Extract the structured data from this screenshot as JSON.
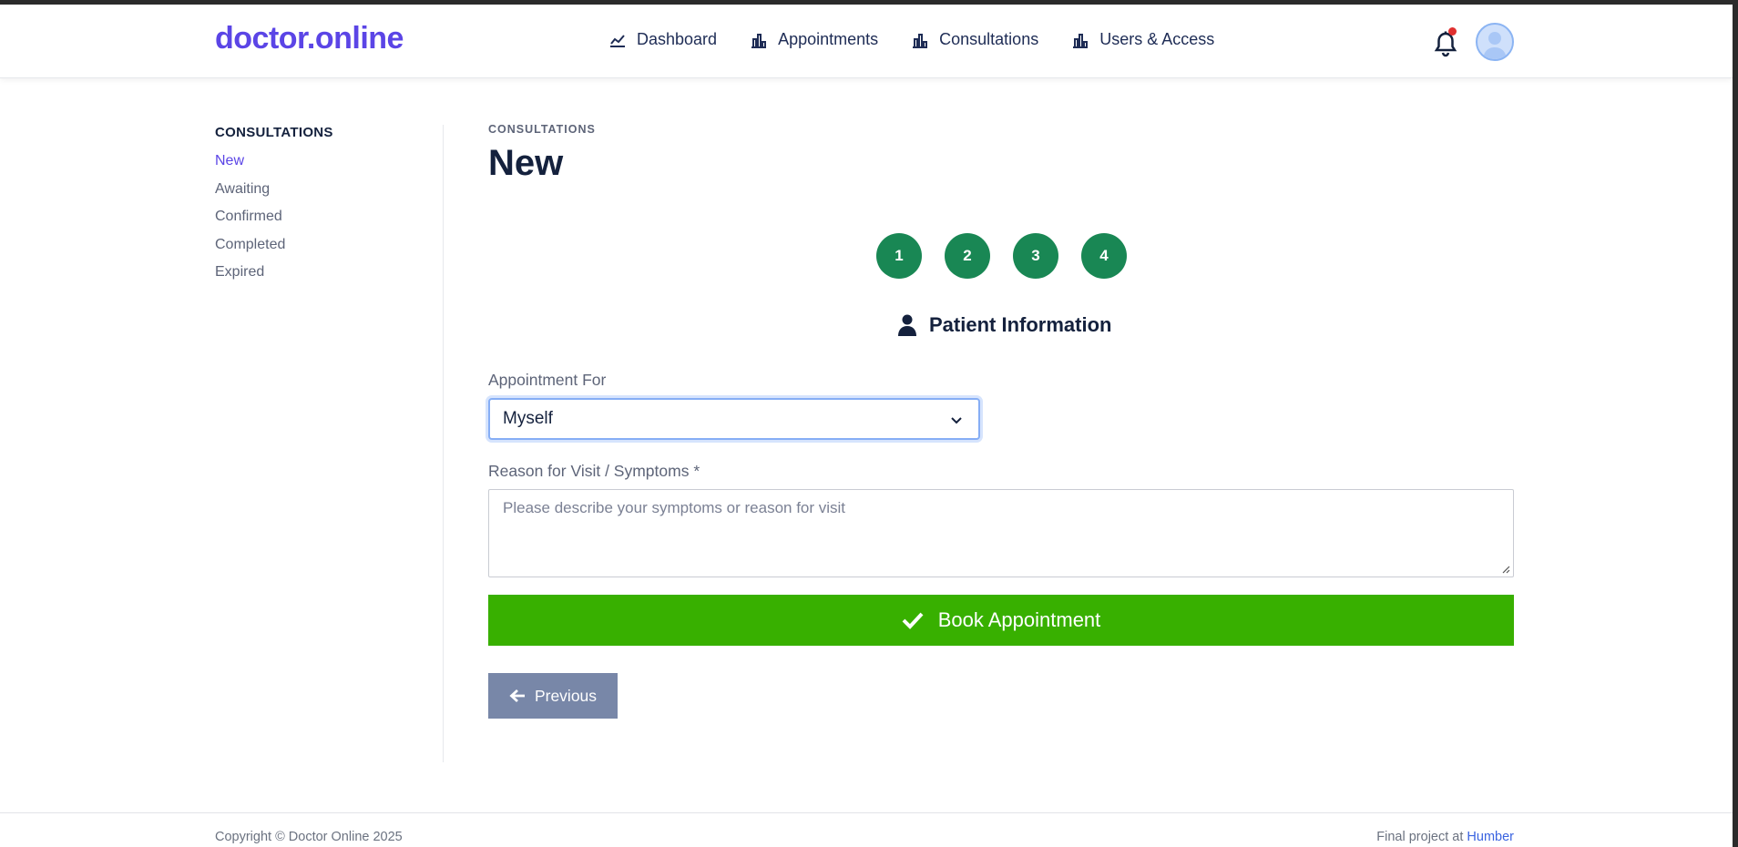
{
  "header": {
    "logo": "doctor.online",
    "nav": [
      {
        "label": "Dashboard",
        "icon": "chart-line-icon"
      },
      {
        "label": "Appointments",
        "icon": "bar-chart-icon"
      },
      {
        "label": "Consultations",
        "icon": "bar-chart-icon"
      },
      {
        "label": "Users & Access",
        "icon": "bar-chart-icon"
      }
    ],
    "notification_icon": "bell-icon",
    "avatar_icon": "user-avatar-icon"
  },
  "sidebar": {
    "title": "CONSULTATIONS",
    "items": [
      {
        "label": "New",
        "active": true
      },
      {
        "label": "Awaiting"
      },
      {
        "label": "Confirmed"
      },
      {
        "label": "Completed"
      },
      {
        "label": "Expired"
      }
    ]
  },
  "main": {
    "breadcrumb": "CONSULTATIONS",
    "title": "New",
    "steps": [
      "1",
      "2",
      "3",
      "4"
    ],
    "section_title": "Patient Information",
    "appointment_for_label": "Appointment For",
    "appointment_for_value": "Myself",
    "reason_label": "Reason for Visit / Symptoms *",
    "reason_placeholder": "Please describe your symptoms or reason for visit",
    "book_button": "Book Appointment",
    "previous_button": "Previous"
  },
  "footer": {
    "copyright": "Copyright © Doctor Online 2025",
    "final_text": "Final project at",
    "link": "Humber"
  },
  "colors": {
    "brand": "#5b45e6",
    "step_green": "#198754",
    "book_green": "#38b000",
    "previous_gray": "#7887a8"
  }
}
